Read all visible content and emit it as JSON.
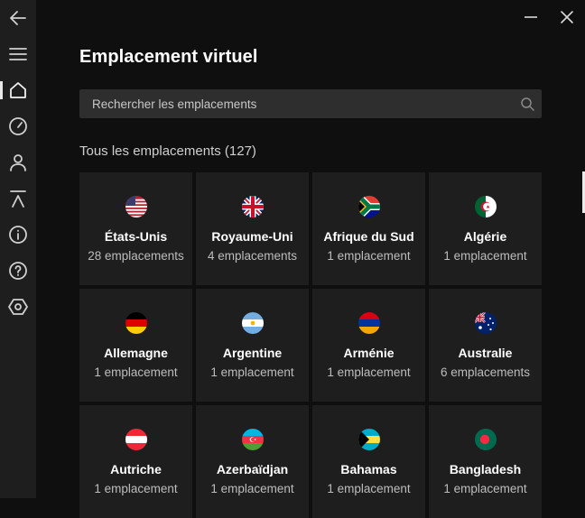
{
  "window": {
    "minimize_icon": "minimize-icon",
    "close_icon": "close-icon"
  },
  "sidebar": {
    "items": [
      {
        "icon": "back-arrow-icon",
        "label": "Retour"
      },
      {
        "icon": "menu-icon",
        "label": "Menu"
      },
      {
        "icon": "home-icon",
        "label": "Accueil",
        "active": true
      },
      {
        "icon": "speedometer-icon",
        "label": "Vitesse"
      },
      {
        "icon": "person-icon",
        "label": "Compte"
      },
      {
        "icon": "upload-icon",
        "label": "Mise à jour"
      },
      {
        "icon": "info-icon",
        "label": "Informations"
      },
      {
        "icon": "help-icon",
        "label": "Aide"
      },
      {
        "icon": "settings-hexagon-icon",
        "label": "Paramètres"
      }
    ]
  },
  "main": {
    "title": "Emplacement virtuel",
    "search": {
      "placeholder": "Rechercher les emplacements",
      "value": "",
      "icon": "search-icon"
    },
    "section_label": "Tous les emplacements (127)",
    "locations": [
      {
        "name": "États-Unis",
        "count": "28 emplacements",
        "flag": "us-flag-icon"
      },
      {
        "name": "Royaume-Uni",
        "count": "4 emplacements",
        "flag": "uk-flag-icon"
      },
      {
        "name": "Afrique du Sud",
        "count": "1 emplacement",
        "flag": "south-africa-flag-icon"
      },
      {
        "name": "Algérie",
        "count": "1 emplacement",
        "flag": "algeria-flag-icon"
      },
      {
        "name": "Allemagne",
        "count": "1 emplacement",
        "flag": "germany-flag-icon"
      },
      {
        "name": "Argentine",
        "count": "1 emplacement",
        "flag": "argentina-flag-icon"
      },
      {
        "name": "Arménie",
        "count": "1 emplacement",
        "flag": "armenia-flag-icon"
      },
      {
        "name": "Australie",
        "count": "6 emplacements",
        "flag": "australia-flag-icon"
      },
      {
        "name": "Autriche",
        "count": "1 emplacement",
        "flag": "austria-flag-icon"
      },
      {
        "name": "Azerbaïdjan",
        "count": "1 emplacement",
        "flag": "azerbaijan-flag-icon"
      },
      {
        "name": "Bahamas",
        "count": "1 emplacement",
        "flag": "bahamas-flag-icon"
      },
      {
        "name": "Bangladesh",
        "count": "1 emplacement",
        "flag": "bangladesh-flag-icon"
      }
    ]
  },
  "colors": {
    "background": "#0f0f0f",
    "sidebar": "#1e1e1e",
    "card": "#1e1e1e",
    "search": "#2e2e2e",
    "icon": "#d0d0d0",
    "secondary_text": "#bdbdbd"
  }
}
